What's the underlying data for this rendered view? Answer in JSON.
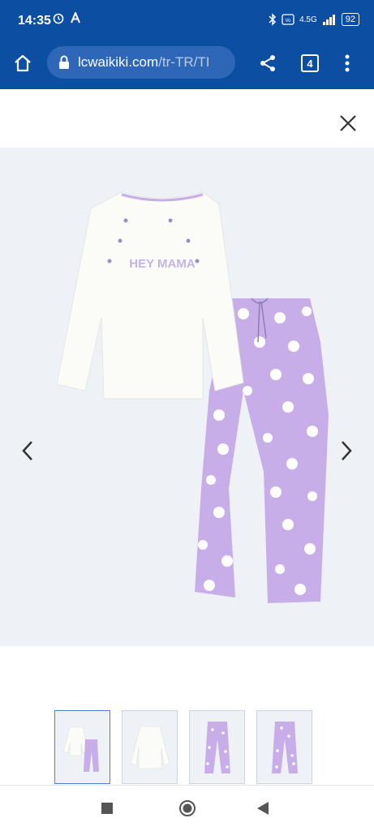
{
  "status_bar": {
    "time": "14:35",
    "battery": "92",
    "network": "4.5G",
    "icons": [
      "alarm-icon",
      "a-icon",
      "bluetooth-icon",
      "volte-icon",
      "signal-icon",
      "battery-icon"
    ]
  },
  "browser": {
    "url_domain": "lcwaikiki.com",
    "url_path": "/tr-TR/TI",
    "tab_count": "4",
    "icons": [
      "home-icon",
      "lock-icon",
      "share-icon",
      "tabs-icon",
      "more-icon"
    ]
  },
  "gallery": {
    "artwork_text": "HEY MAMA",
    "colors": {
      "top": "#fbfbf8",
      "pants": "#c7aee8",
      "dots": "#ffffff",
      "background": "#eef1f5"
    },
    "thumbnails": [
      "full-set",
      "top-only",
      "pants-front",
      "pants-back"
    ],
    "active_thumbnail": 1
  },
  "nav": {
    "icons": [
      "recents-icon",
      "home-icon",
      "back-icon"
    ]
  }
}
